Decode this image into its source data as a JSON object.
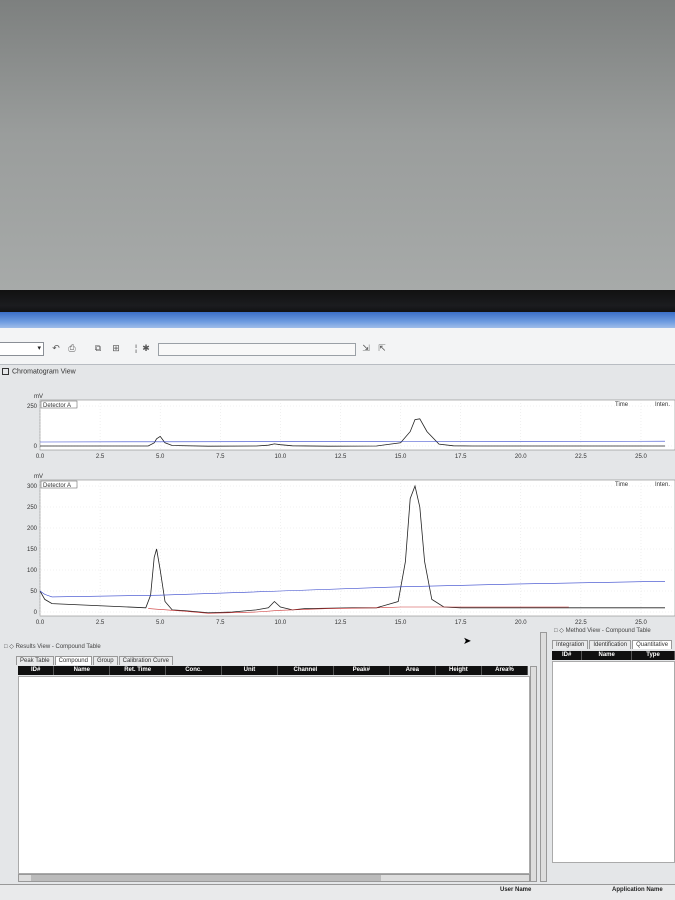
{
  "app": {
    "section_title": "Chromatogram View",
    "toolbar_icons": [
      "undo-icon",
      "print-icon",
      "copy-icon",
      "zoom-icon",
      "cursor-icon",
      "pin-icon",
      "settings-icon"
    ]
  },
  "chart_data": [
    {
      "type": "line",
      "title": "",
      "ylabel": "mV",
      "legend": "Detector A",
      "right_labels": [
        "Time",
        "Inten."
      ],
      "ylim": [
        0,
        250
      ],
      "yticks": [
        "250",
        "0"
      ],
      "xlim": [
        0,
        26
      ],
      "xticks": [
        "0.0",
        "2.5",
        "5.0",
        "7.5",
        "10.0",
        "12.5",
        "15.0",
        "17.5",
        "20.0",
        "22.5",
        "25.0"
      ],
      "series": [
        {
          "color": "#222222",
          "x": [
            0,
            4.5,
            4.75,
            4.85,
            5.0,
            5.2,
            5.5,
            7,
            9,
            9.5,
            9.75,
            10,
            10.5,
            12,
            14,
            15.0,
            15.4,
            15.6,
            15.8,
            16.1,
            16.6,
            17.2,
            18,
            26
          ],
          "y": [
            0,
            0,
            20,
            45,
            60,
            20,
            3,
            -1,
            0,
            5,
            13,
            8,
            1,
            -1,
            0,
            20,
            90,
            165,
            170,
            90,
            12,
            1,
            0,
            0
          ]
        },
        {
          "color": "#3344cc",
          "x": [
            0,
            5,
            10,
            15,
            20,
            26
          ],
          "y": [
            25,
            26,
            27,
            28,
            29,
            30
          ]
        }
      ]
    },
    {
      "type": "line",
      "title": "",
      "ylabel": "mV",
      "legend": "Detector A",
      "right_labels": [
        "Time",
        "Inten."
      ],
      "ylim": [
        0,
        300
      ],
      "yticks": [
        "300",
        "250",
        "200",
        "150",
        "100",
        "50",
        "0"
      ],
      "xlim": [
        0,
        26
      ],
      "xticks": [
        "0.0",
        "2.5",
        "5.0",
        "7.5",
        "10.0",
        "12.5",
        "15.0",
        "17.5",
        "20.0",
        "22.5",
        "25.0"
      ],
      "series": [
        {
          "color": "#222222",
          "x": [
            0,
            0.2,
            0.5,
            4.4,
            4.6,
            4.75,
            4.85,
            5.0,
            5.2,
            5.5,
            6,
            7,
            8,
            9,
            9.5,
            9.75,
            10,
            10.5,
            11,
            13,
            14,
            14.9,
            15.2,
            15.4,
            15.6,
            15.8,
            16.0,
            16.3,
            16.8,
            17.5,
            18,
            26
          ],
          "y": [
            50,
            30,
            20,
            10,
            40,
            130,
            150,
            100,
            25,
            5,
            3,
            -2,
            0,
            5,
            10,
            25,
            12,
            5,
            8,
            10,
            10,
            25,
            120,
            270,
            300,
            250,
            120,
            30,
            12,
            10,
            10,
            10
          ]
        },
        {
          "color": "#3344cc",
          "x": [
            0,
            0.2,
            0.5,
            5,
            10,
            15,
            20,
            26
          ],
          "y": [
            50,
            42,
            36,
            40,
            50,
            60,
            67,
            73
          ]
        },
        {
          "color": "#cc3333",
          "x": [
            4.5,
            6,
            7,
            9,
            10,
            12,
            14,
            15,
            18,
            22
          ],
          "y": [
            8,
            2,
            -3,
            0,
            4,
            8,
            10,
            12,
            12,
            12
          ]
        }
      ]
    }
  ],
  "results_view": {
    "title": "Results View - Compound Table",
    "tabs": [
      "Peak Table",
      "Compound",
      "Group",
      "Calibration Curve"
    ],
    "columns": [
      "ID#",
      "Name",
      "Ret. Time",
      "Conc.",
      "Unit",
      "Channel",
      "Peak#",
      "Area",
      "Height",
      "Area%"
    ]
  },
  "method_view": {
    "title": "Method View - Compound Table",
    "tabs": [
      "Integration",
      "Identification",
      "Quantitative"
    ],
    "columns": [
      "ID#",
      "Name",
      "Type"
    ]
  },
  "statusbar": {
    "user": "User Name",
    "application": "Application Name"
  }
}
